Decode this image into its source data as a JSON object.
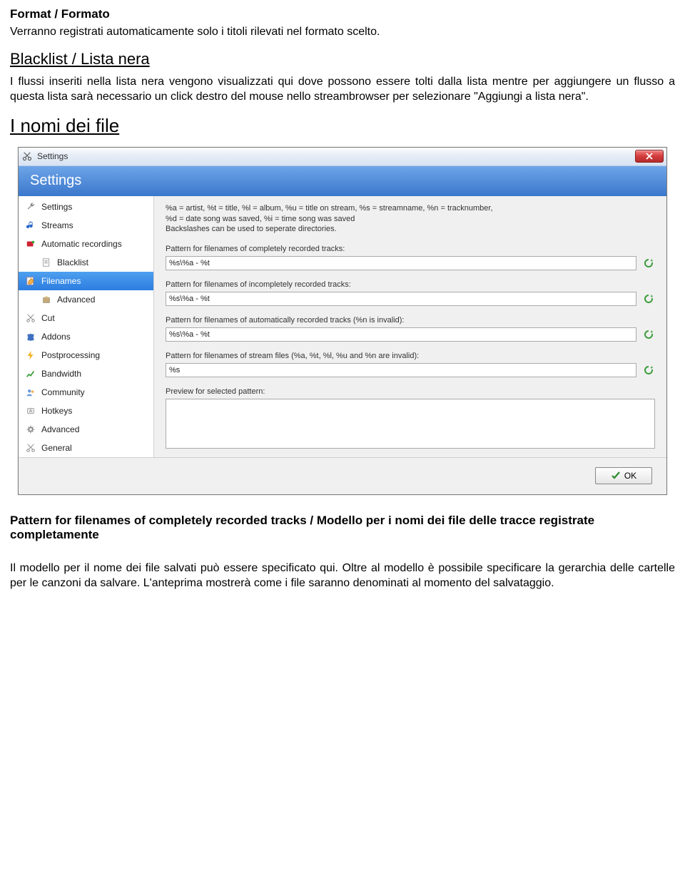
{
  "doc": {
    "h1": "Format / Formato",
    "p1": "Verranno registrati automaticamente solo i titoli rilevati nel formato scelto.",
    "h2": "Blacklist / Lista nera",
    "p2": "I flussi inseriti nella lista nera vengono visualizzati qui dove possono essere tolti dalla lista mentre per aggiungere un flusso a questa lista sarà necessario un click destro del mouse nello streambrowser per selezionare \"Aggiungi a lista nera\".",
    "h3": "I nomi dei file",
    "h4": "Pattern for filenames of completely recorded tracks / Modello per i nomi dei file delle tracce registrate completamente",
    "p3": "Il modello per il nome dei file salvati può essere specificato qui. Oltre al  modello è possibile specificare la gerarchia delle cartelle per le canzoni da salvare. L'anteprima mostrerà come i file saranno denominati al momento del salvataggio."
  },
  "dialog": {
    "title": "Settings",
    "banner": "Settings",
    "sidebar": [
      {
        "label": "Settings",
        "indent": false,
        "icon": "wrench",
        "selected": false
      },
      {
        "label": "Streams",
        "indent": false,
        "icon": "note",
        "selected": false
      },
      {
        "label": "Automatic recordings",
        "indent": false,
        "icon": "rec",
        "selected": false
      },
      {
        "label": "Blacklist",
        "indent": true,
        "icon": "page",
        "selected": false
      },
      {
        "label": "Filenames",
        "indent": false,
        "icon": "pencil",
        "selected": true
      },
      {
        "label": "Advanced",
        "indent": true,
        "icon": "box",
        "selected": false
      },
      {
        "label": "Cut",
        "indent": false,
        "icon": "scissors",
        "selected": false
      },
      {
        "label": "Addons",
        "indent": false,
        "icon": "puzzle",
        "selected": false
      },
      {
        "label": "Postprocessing",
        "indent": false,
        "icon": "bolt",
        "selected": false
      },
      {
        "label": "Bandwidth",
        "indent": false,
        "icon": "chart",
        "selected": false
      },
      {
        "label": "Community",
        "indent": false,
        "icon": "users",
        "selected": false
      },
      {
        "label": "Hotkeys",
        "indent": false,
        "icon": "key",
        "selected": false
      },
      {
        "label": "Advanced",
        "indent": false,
        "icon": "gear",
        "selected": false
      },
      {
        "label": "General",
        "indent": false,
        "icon": "scissors2",
        "selected": false
      }
    ],
    "hint1": "%a = artist, %t = title, %l = album, %u = title on stream, %s = streamname, %n = tracknumber,",
    "hint2": "%d = date song was saved, %i = time song was saved",
    "hint3": "Backslashes can be used to seperate directories.",
    "f1label": "Pattern for filenames of completely recorded tracks:",
    "f1val": "%s\\%a - %t",
    "f2label": "Pattern for filenames of incompletely recorded tracks:",
    "f2val": "%s\\%a - %t",
    "f3label": "Pattern for filenames of automatically recorded tracks (%n is invalid):",
    "f3val": "%s\\%a - %t",
    "f4label": "Pattern for filenames of stream files (%a, %t, %l, %u and %n are invalid):",
    "f4val": "%s",
    "previewlabel": "Preview for selected pattern:",
    "previewval": "",
    "ok": "OK"
  }
}
